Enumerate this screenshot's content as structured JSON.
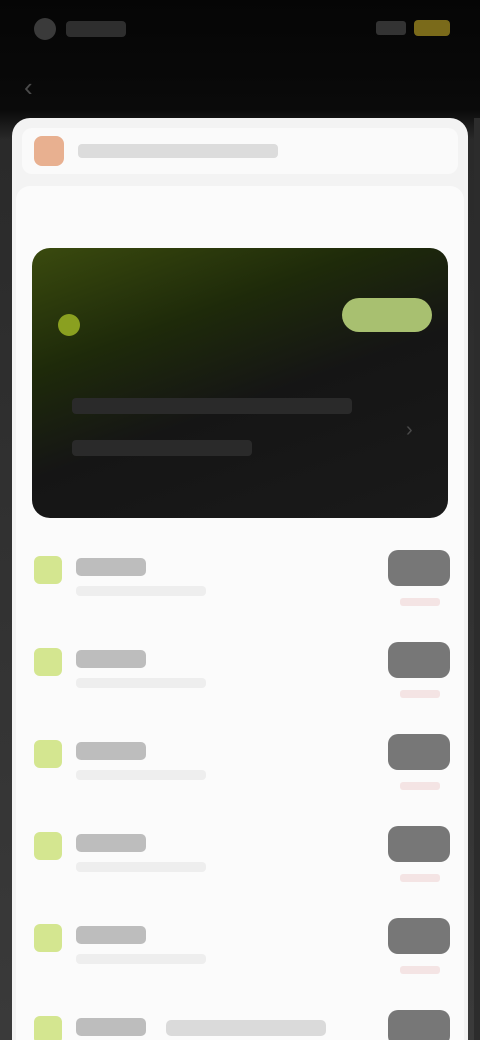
{
  "status_bar": {
    "time": "",
    "battery_color": "#7a6a1a"
  },
  "nav": {
    "title": "",
    "back_label": "‹"
  },
  "notice": {
    "text": ""
  },
  "section": {
    "label": ""
  },
  "featured": {
    "title": "",
    "subtitle": "",
    "badge": "",
    "description_line1": "",
    "description_line2": "",
    "chevron": "›",
    "accent_color": "#8aa020"
  },
  "list": {
    "items": [
      {
        "title": "",
        "button": ""
      },
      {
        "title": "",
        "button": ""
      },
      {
        "title": "",
        "button": ""
      },
      {
        "title": "",
        "button": ""
      },
      {
        "title": "",
        "button": ""
      },
      {
        "title": "",
        "button": ""
      }
    ]
  },
  "colors": {
    "accent": "#d4e690",
    "panel": "#fbfbfb",
    "background": "#0a0a0a"
  }
}
